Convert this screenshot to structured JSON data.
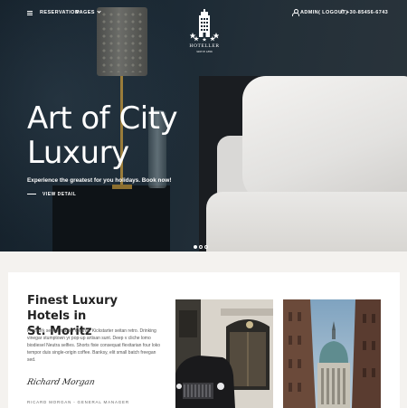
{
  "nav": {
    "reservation": "RESERVATION",
    "pages": "PAGES",
    "account": "ADMIN( LOGOUT)",
    "phone": "+30-85456-6743"
  },
  "logo": {
    "name": "HOTELLER",
    "since": "SINCE 1896"
  },
  "hero": {
    "title_line1": "Art of City",
    "title_line2": "Luxury",
    "subtitle": "Experience the greatest for you holidays. Book now!",
    "cta": "VIEW DETAIL",
    "slides": 3,
    "active_slide": 1
  },
  "about": {
    "title_line1": "Finest Luxury Hotels in",
    "title_line2": "St. Moritz",
    "text": "Pitchfork selfies master cleanse Kickstarter seitan retro. Drinking vinegar stumptown yr pop-up artisan sunt. Deep v cliche lomo biodiesel Neutra selfies. Shorts fixie consequat flexitarian four loko tempor duis single-origin coffee. Banksy, elit small batch freegan sed.",
    "signature": "Richard Morgan",
    "caption": "RICARD MORGAN - GENERAL MANAGER"
  },
  "icons": {
    "menu": "menu-icon",
    "user": "user-icon",
    "phone": "phone-icon",
    "logo": "hotel-building-icon"
  },
  "colors": {
    "hero_bg": "#1c2a35",
    "content_bg": "#ffffff",
    "page_bg": "#f4f2ef",
    "text_dark": "#222222"
  }
}
